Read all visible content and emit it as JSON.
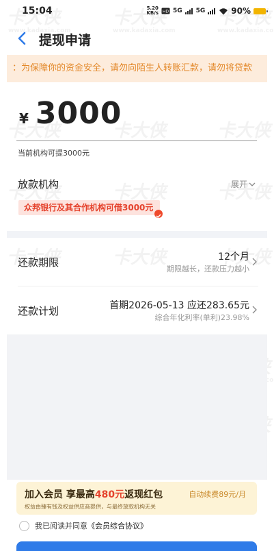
{
  "status_bar": {
    "time": "15:04",
    "net_speed_top": "5.20",
    "net_speed_bottom": "KB/s",
    "signal1": "5G",
    "signal2": "5G",
    "battery_pct": "90%",
    "battery_color": "#f2b400"
  },
  "nav": {
    "title": "提现申请",
    "back_icon": "chevron-left-icon"
  },
  "notice": {
    "text": "：为保障你的资金安全，请勿向陌生人转账汇款，请勿将贷款"
  },
  "amount": {
    "currency": "¥",
    "value": "3000",
    "limit_text": "当前机构可提3000元"
  },
  "lender": {
    "label": "放款机构",
    "expand_label": "展开",
    "badge_text": "众邦银行及其合作机构可借3000元"
  },
  "term": {
    "label": "还款期限",
    "value": "12个月",
    "sub": "期限越长，还款压力越小"
  },
  "plan": {
    "label": "还款计划",
    "value": "首期2026-05-13 应还283.65元",
    "sub": "综合年化利率(单利)23.98%"
  },
  "member": {
    "title_prefix": "加入会员 享最高",
    "title_amount": "480元",
    "title_suffix": "返现红包",
    "auto_renew": "自动续费89元/月",
    "note": "权益由臻有钱及权益供应商提供，与最终放款机构无关"
  },
  "agreement": {
    "prefix": "我已阅读并同意",
    "link": "《会员综合协议》"
  },
  "watermark": {
    "logo": "卡大侠",
    "url": "www.kadaxia.com"
  },
  "colors": {
    "primary_blue": "#2f7be8",
    "notice_orange": "#e3892b",
    "badge_red": "#e5432d"
  }
}
